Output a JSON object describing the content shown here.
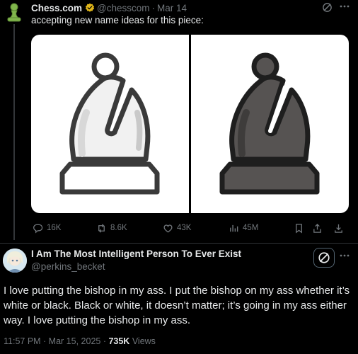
{
  "original_post": {
    "author_name": "Chess.com",
    "handle": "@chesscom",
    "separator": "·",
    "date": "Mar 14",
    "text": "accepting new name ideas for this piece:",
    "stats": {
      "replies": "16K",
      "reposts": "8.6K",
      "likes": "43K",
      "views": "45M"
    }
  },
  "reply": {
    "author_name": "I Am The Most Intelligent Person To Ever Exist",
    "handle": "@perkins_becket",
    "body": "I love putting the bishop in my ass. I put the bishop on my ass whether it’s white or black. Black or white, it doesn’t matter; it’s going in my ass either way. I love putting the bishop in my ass.",
    "timestamp": "11:57 PM · Mar 15, 2025 · ",
    "views_count": "735K",
    "views_label": " Views"
  },
  "icons": {
    "avatar_original": "pawn-icon",
    "verified": "verified-badge-icon",
    "grok": "grok-icon",
    "more": "more-icon",
    "reply": "reply-icon",
    "repost": "repost-icon",
    "like": "heart-icon",
    "views": "views-icon",
    "bookmark": "bookmark-icon",
    "share": "share-icon",
    "download": "download-icon"
  },
  "colors": {
    "background": "#000000",
    "text_primary": "#e7e9ea",
    "text_secondary": "#71767b",
    "verified": "#e2b719",
    "pawn_green": "#81b64c",
    "bishop_white": "#ffffff",
    "bishop_black": "#565352"
  }
}
